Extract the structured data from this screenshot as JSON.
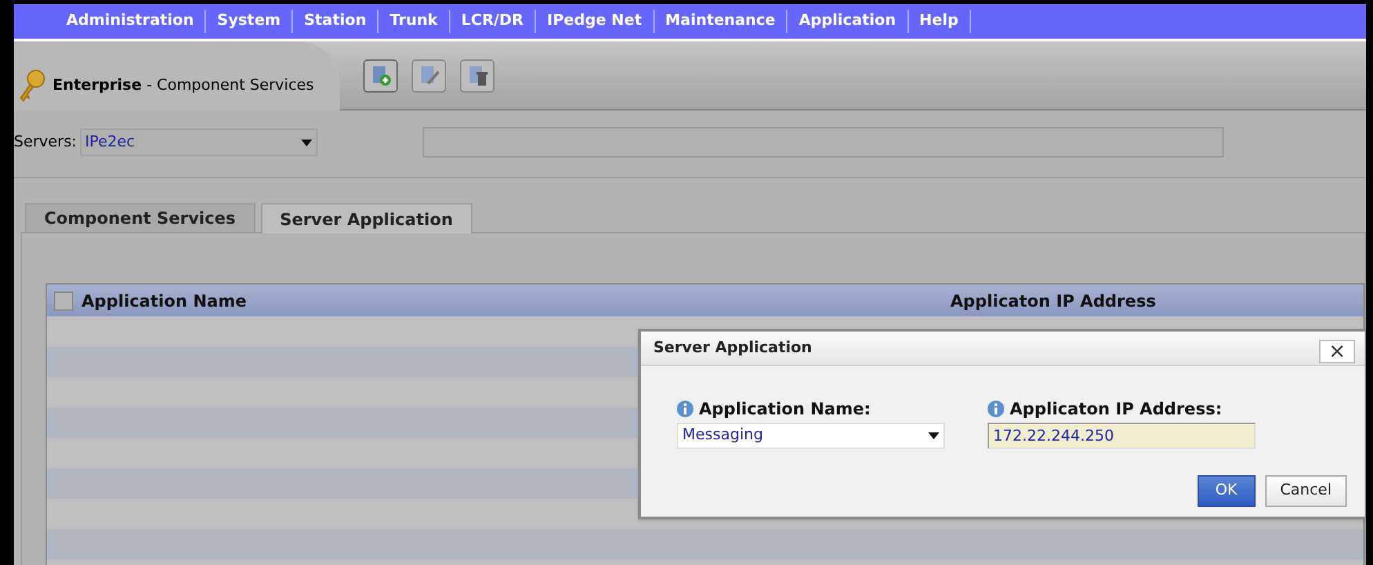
{
  "menu": [
    {
      "label": "Administration"
    },
    {
      "label": "System"
    },
    {
      "label": "Station"
    },
    {
      "label": "Trunk"
    },
    {
      "label": "LCR/DR"
    },
    {
      "label": "IPedge Net"
    },
    {
      "label": "Maintenance"
    },
    {
      "label": "Application"
    },
    {
      "label": "Help"
    }
  ],
  "header": {
    "title": "**Enterprise** - Component Services"
  },
  "servers": {
    "label": "Servers:",
    "value": "IPe2ec"
  },
  "tabs": [
    {
      "label": "Component Services",
      "selected": false
    },
    {
      "label": "Server Application",
      "selected": true
    }
  ],
  "grid": {
    "select_all_checked": false,
    "columns": [
      "Application Name",
      "Applicaton IP Address"
    ]
  },
  "dialog": {
    "title": "Server Application",
    "close": "×",
    "fields": [
      {
        "kind": "select",
        "label": "Application Name:",
        "value": "Messaging"
      },
      {
        "kind": "text",
        "label": "Applicaton IP Address:",
        "value": "172.22.244.250"
      }
    ],
    "buttons": [
      {
        "label": "OK",
        "primary": true
      },
      {
        "label": "Cancel",
        "primary": false
      }
    ]
  }
}
